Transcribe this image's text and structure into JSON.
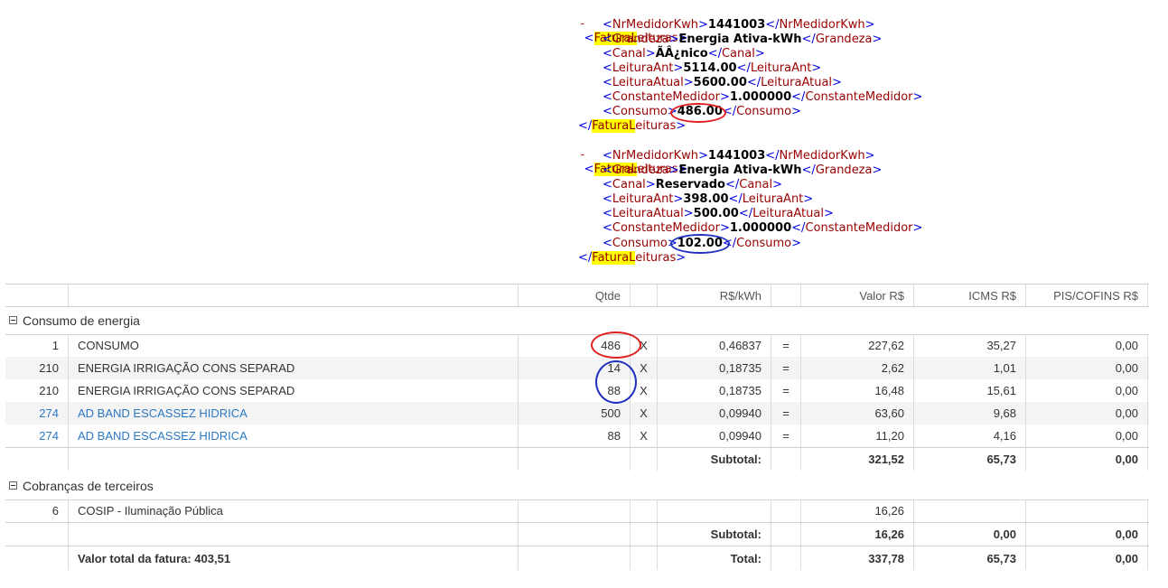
{
  "xml": {
    "blocks": [
      {
        "open_tag": "FaturaLeituras",
        "fields": [
          {
            "tag": "NrMedidorKwh",
            "value": "1441003"
          },
          {
            "tag": "Grandeza",
            "value": "Energia Ativa-kWh"
          },
          {
            "tag": "Canal",
            "value": "ÃÂ¿nico"
          },
          {
            "tag": "LeituraAnt",
            "value": "5114.00"
          },
          {
            "tag": "LeituraAtual",
            "value": "5600.00"
          },
          {
            "tag": "ConstanteMedidor",
            "value": "1.000000"
          },
          {
            "tag": "Consumo",
            "value": "486.00"
          }
        ]
      },
      {
        "open_tag": "FaturaLeituras",
        "fields": [
          {
            "tag": "NrMedidorKwh",
            "value": "1441003"
          },
          {
            "tag": "Grandeza",
            "value": "Energia Ativa-kWh"
          },
          {
            "tag": "Canal",
            "value": "Reservado"
          },
          {
            "tag": "LeituraAnt",
            "value": "398.00"
          },
          {
            "tag": "LeituraAtual",
            "value": "500.00"
          },
          {
            "tag": "ConstanteMedidor",
            "value": "1.000000"
          },
          {
            "tag": "Consumo",
            "value": "102.00"
          }
        ]
      }
    ]
  },
  "table": {
    "headers": {
      "qtde": "Qtde",
      "rate": "R$/kWh",
      "valor": "Valor R$",
      "icms": "ICMS R$",
      "pis": "PIS/COFINS R$"
    },
    "group1": {
      "title": "Consumo de energia",
      "rows": [
        {
          "code": "1",
          "desc": "CONSUMO",
          "qty": "486",
          "x": "X",
          "rate": "0,46837",
          "eq": "=",
          "valor": "227,62",
          "icms": "35,27",
          "pis": "0,00"
        },
        {
          "code": "210",
          "desc": "ENERGIA IRRIGAÇÃO CONS SEPARAD",
          "qty": "14",
          "x": "X",
          "rate": "0,18735",
          "eq": "=",
          "valor": "2,62",
          "icms": "1,01",
          "pis": "0,00"
        },
        {
          "code": "210",
          "desc": "ENERGIA IRRIGAÇÃO CONS SEPARAD",
          "qty": "88",
          "x": "X",
          "rate": "0,18735",
          "eq": "=",
          "valor": "16,48",
          "icms": "15,61",
          "pis": "0,00"
        },
        {
          "code": "274",
          "desc": "AD BAND ESCASSEZ HIDRICA",
          "qty": "500",
          "x": "X",
          "rate": "0,09940",
          "eq": "=",
          "valor": "63,60",
          "icms": "9,68",
          "pis": "0,00"
        },
        {
          "code": "274",
          "desc": "AD BAND ESCASSEZ HIDRICA",
          "qty": "88",
          "x": "X",
          "rate": "0,09940",
          "eq": "=",
          "valor": "11,20",
          "icms": "4,16",
          "pis": "0,00"
        }
      ],
      "subtotal": {
        "label": "Subtotal:",
        "valor": "321,52",
        "icms": "65,73",
        "pis": "0,00"
      }
    },
    "group2": {
      "title": "Cobranças de terceiros",
      "rows": [
        {
          "code": "6",
          "desc": "COSIP - Iluminação Pública",
          "valor": "16,26"
        }
      ],
      "subtotal": {
        "label": "Subtotal:",
        "valor": "16,26",
        "icms": "0,00",
        "pis": "0,00"
      }
    },
    "total": {
      "invoice_label": "Valor total da fatura: 403,51",
      "label": "Total:",
      "valor": "337,78",
      "icms": "65,73",
      "pis": "0,00"
    }
  },
  "colors": {
    "annotation_red": "#e02020",
    "annotation_blue": "#2030c0",
    "highlight": "#ffff00",
    "link": "#2b78c4"
  }
}
